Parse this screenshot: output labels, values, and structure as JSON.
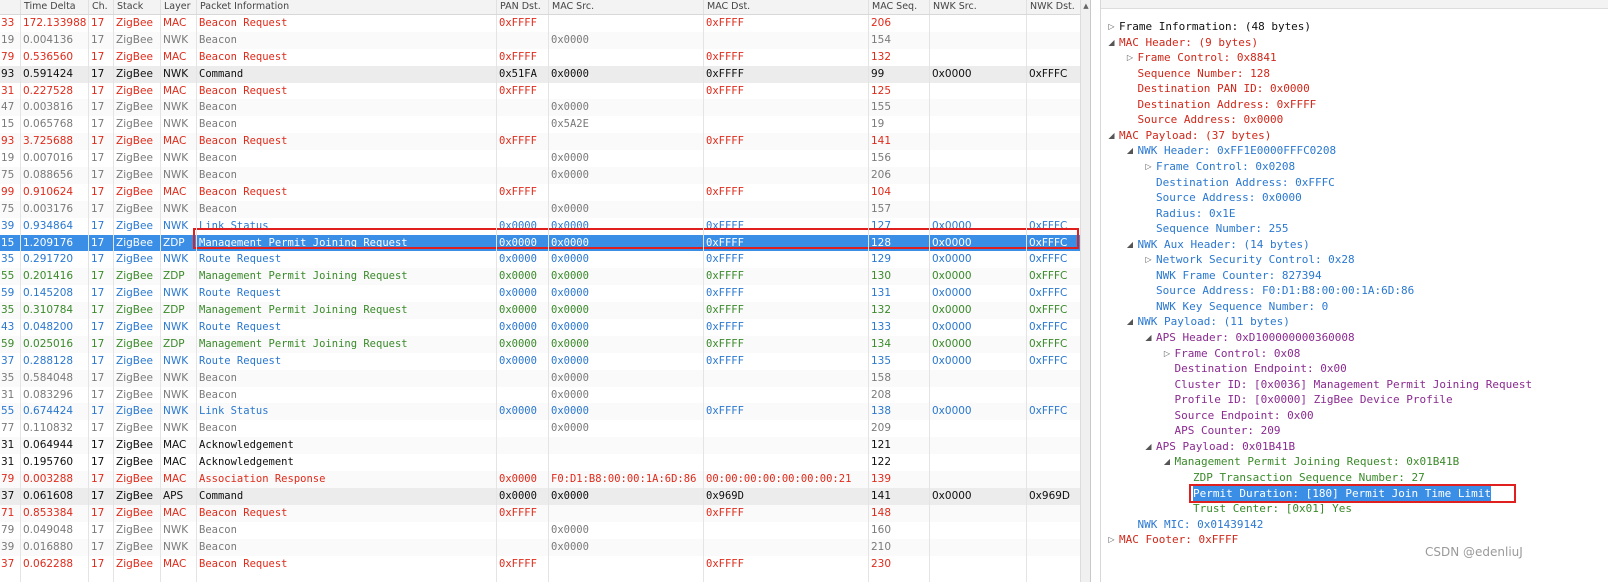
{
  "columns": [
    "Time Delta",
    "Ch.",
    "Stack",
    "Layer",
    "Packet Information",
    "PAN Dst.",
    "MAC Src.",
    "MAC Dst.",
    "MAC Seq.",
    "NWK Src.",
    "NWK Dst."
  ],
  "colors": {
    "beacon_req": "#e02a1a",
    "nwk": "#7a7a7a",
    "link": "#2a78d0",
    "zdp": "#3a8a2a",
    "ack": "#101010",
    "cmd": "#101010",
    "selected_bg": "#3a8ee6",
    "highlight_border": "#e0201e"
  },
  "rows": [
    {
      "no": "33",
      "delta": "172.133988",
      "ch": "17",
      "stack": "ZigBee",
      "layer": "MAC",
      "info": "Beacon Request",
      "pan": "0xFFFF",
      "msrc": "",
      "mdst": "0xFFFF",
      "seq": "206",
      "nsrc": "",
      "ndst": "",
      "kind": "beacon_req"
    },
    {
      "no": "19",
      "delta": "0.004136",
      "ch": "17",
      "stack": "ZigBee",
      "layer": "NWK",
      "info": "Beacon",
      "pan": "",
      "msrc": "0x0000",
      "mdst": "",
      "seq": "154",
      "nsrc": "",
      "ndst": "",
      "kind": "nwk"
    },
    {
      "no": "79",
      "delta": "0.536560",
      "ch": "17",
      "stack": "ZigBee",
      "layer": "MAC",
      "info": "Beacon Request",
      "pan": "0xFFFF",
      "msrc": "",
      "mdst": "0xFFFF",
      "seq": "132",
      "nsrc": "",
      "ndst": "",
      "kind": "beacon_req"
    },
    {
      "no": "93",
      "delta": "0.591424",
      "ch": "17",
      "stack": "ZigBee",
      "layer": "NWK",
      "info": "Command",
      "pan": "0x51FA",
      "msrc": "0x0000",
      "mdst": "0xFFFF",
      "seq": "99",
      "nsrc": "0x0000",
      "ndst": "0xFFFC",
      "kind": "cmd"
    },
    {
      "no": "31",
      "delta": "0.227528",
      "ch": "17",
      "stack": "ZigBee",
      "layer": "MAC",
      "info": "Beacon Request",
      "pan": "0xFFFF",
      "msrc": "",
      "mdst": "0xFFFF",
      "seq": "125",
      "nsrc": "",
      "ndst": "",
      "kind": "beacon_req"
    },
    {
      "no": "47",
      "delta": "0.003816",
      "ch": "17",
      "stack": "ZigBee",
      "layer": "NWK",
      "info": "Beacon",
      "pan": "",
      "msrc": "0x0000",
      "mdst": "",
      "seq": "155",
      "nsrc": "",
      "ndst": "",
      "kind": "nwk"
    },
    {
      "no": "15",
      "delta": "0.065768",
      "ch": "17",
      "stack": "ZigBee",
      "layer": "NWK",
      "info": "Beacon",
      "pan": "",
      "msrc": "0x5A2E",
      "mdst": "",
      "seq": "19",
      "nsrc": "",
      "ndst": "",
      "kind": "nwk"
    },
    {
      "no": "93",
      "delta": "3.725688",
      "ch": "17",
      "stack": "ZigBee",
      "layer": "MAC",
      "info": "Beacon Request",
      "pan": "0xFFFF",
      "msrc": "",
      "mdst": "0xFFFF",
      "seq": "141",
      "nsrc": "",
      "ndst": "",
      "kind": "beacon_req"
    },
    {
      "no": "19",
      "delta": "0.007016",
      "ch": "17",
      "stack": "ZigBee",
      "layer": "NWK",
      "info": "Beacon",
      "pan": "",
      "msrc": "0x0000",
      "mdst": "",
      "seq": "156",
      "nsrc": "",
      "ndst": "",
      "kind": "nwk"
    },
    {
      "no": "75",
      "delta": "0.088656",
      "ch": "17",
      "stack": "ZigBee",
      "layer": "NWK",
      "info": "Beacon",
      "pan": "",
      "msrc": "0x0000",
      "mdst": "",
      "seq": "206",
      "nsrc": "",
      "ndst": "",
      "kind": "nwk"
    },
    {
      "no": "99",
      "delta": "0.910624",
      "ch": "17",
      "stack": "ZigBee",
      "layer": "MAC",
      "info": "Beacon Request",
      "pan": "0xFFFF",
      "msrc": "",
      "mdst": "0xFFFF",
      "seq": "104",
      "nsrc": "",
      "ndst": "",
      "kind": "beacon_req"
    },
    {
      "no": "75",
      "delta": "0.003176",
      "ch": "17",
      "stack": "ZigBee",
      "layer": "NWK",
      "info": "Beacon",
      "pan": "",
      "msrc": "0x0000",
      "mdst": "",
      "seq": "157",
      "nsrc": "",
      "ndst": "",
      "kind": "nwk"
    },
    {
      "no": "39",
      "delta": "0.934864",
      "ch": "17",
      "stack": "ZigBee",
      "layer": "NWK",
      "info": "Link Status",
      "pan": "0x0000",
      "msrc": "0x0000",
      "mdst": "0xFFFF",
      "seq": "127",
      "nsrc": "0x0000",
      "ndst": "0xFFFC",
      "kind": "link"
    },
    {
      "no": "15",
      "delta": "1.209176",
      "ch": "17",
      "stack": "ZigBee",
      "layer": "ZDP",
      "info": "Management Permit Joining Request",
      "pan": "0x0000",
      "msrc": "0x0000",
      "mdst": "0xFFFF",
      "seq": "128",
      "nsrc": "0x0000",
      "ndst": "0xFFFC",
      "kind": "zdp",
      "selected": true
    },
    {
      "no": "35",
      "delta": "0.291720",
      "ch": "17",
      "stack": "ZigBee",
      "layer": "NWK",
      "info": "Route Request",
      "pan": "0x0000",
      "msrc": "0x0000",
      "mdst": "0xFFFF",
      "seq": "129",
      "nsrc": "0x0000",
      "ndst": "0xFFFC",
      "kind": "link"
    },
    {
      "no": "55",
      "delta": "0.201416",
      "ch": "17",
      "stack": "ZigBee",
      "layer": "ZDP",
      "info": "Management Permit Joining Request",
      "pan": "0x0000",
      "msrc": "0x0000",
      "mdst": "0xFFFF",
      "seq": "130",
      "nsrc": "0x0000",
      "ndst": "0xFFFC",
      "kind": "zdp"
    },
    {
      "no": "59",
      "delta": "0.145208",
      "ch": "17",
      "stack": "ZigBee",
      "layer": "NWK",
      "info": "Route Request",
      "pan": "0x0000",
      "msrc": "0x0000",
      "mdst": "0xFFFF",
      "seq": "131",
      "nsrc": "0x0000",
      "ndst": "0xFFFC",
      "kind": "link"
    },
    {
      "no": "35",
      "delta": "0.310784",
      "ch": "17",
      "stack": "ZigBee",
      "layer": "ZDP",
      "info": "Management Permit Joining Request",
      "pan": "0x0000",
      "msrc": "0x0000",
      "mdst": "0xFFFF",
      "seq": "132",
      "nsrc": "0x0000",
      "ndst": "0xFFFC",
      "kind": "zdp"
    },
    {
      "no": "43",
      "delta": "0.048200",
      "ch": "17",
      "stack": "ZigBee",
      "layer": "NWK",
      "info": "Route Request",
      "pan": "0x0000",
      "msrc": "0x0000",
      "mdst": "0xFFFF",
      "seq": "133",
      "nsrc": "0x0000",
      "ndst": "0xFFFC",
      "kind": "link"
    },
    {
      "no": "59",
      "delta": "0.025016",
      "ch": "17",
      "stack": "ZigBee",
      "layer": "ZDP",
      "info": "Management Permit Joining Request",
      "pan": "0x0000",
      "msrc": "0x0000",
      "mdst": "0xFFFF",
      "seq": "134",
      "nsrc": "0x0000",
      "ndst": "0xFFFC",
      "kind": "zdp"
    },
    {
      "no": "37",
      "delta": "0.288128",
      "ch": "17",
      "stack": "ZigBee",
      "layer": "NWK",
      "info": "Route Request",
      "pan": "0x0000",
      "msrc": "0x0000",
      "mdst": "0xFFFF",
      "seq": "135",
      "nsrc": "0x0000",
      "ndst": "0xFFFC",
      "kind": "link"
    },
    {
      "no": "35",
      "delta": "0.584048",
      "ch": "17",
      "stack": "ZigBee",
      "layer": "NWK",
      "info": "Beacon",
      "pan": "",
      "msrc": "0x0000",
      "mdst": "",
      "seq": "158",
      "nsrc": "",
      "ndst": "",
      "kind": "nwk"
    },
    {
      "no": "31",
      "delta": "0.083296",
      "ch": "17",
      "stack": "ZigBee",
      "layer": "NWK",
      "info": "Beacon",
      "pan": "",
      "msrc": "0x0000",
      "mdst": "",
      "seq": "208",
      "nsrc": "",
      "ndst": "",
      "kind": "nwk"
    },
    {
      "no": "55",
      "delta": "0.674424",
      "ch": "17",
      "stack": "ZigBee",
      "layer": "NWK",
      "info": "Link Status",
      "pan": "0x0000",
      "msrc": "0x0000",
      "mdst": "0xFFFF",
      "seq": "138",
      "nsrc": "0x0000",
      "ndst": "0xFFFC",
      "kind": "link"
    },
    {
      "no": "77",
      "delta": "0.110832",
      "ch": "17",
      "stack": "ZigBee",
      "layer": "NWK",
      "info": "Beacon",
      "pan": "",
      "msrc": "0x0000",
      "mdst": "",
      "seq": "209",
      "nsrc": "",
      "ndst": "",
      "kind": "nwk"
    },
    {
      "no": "31",
      "delta": "0.064944",
      "ch": "17",
      "stack": "ZigBee",
      "layer": "MAC",
      "info": "Acknowledgement",
      "pan": "",
      "msrc": "",
      "mdst": "",
      "seq": "121",
      "nsrc": "",
      "ndst": "",
      "kind": "ack"
    },
    {
      "no": "31",
      "delta": "0.195760",
      "ch": "17",
      "stack": "ZigBee",
      "layer": "MAC",
      "info": "Acknowledgement",
      "pan": "",
      "msrc": "",
      "mdst": "",
      "seq": "122",
      "nsrc": "",
      "ndst": "",
      "kind": "ack"
    },
    {
      "no": "79",
      "delta": "0.003288",
      "ch": "17",
      "stack": "ZigBee",
      "layer": "MAC",
      "info": "Association Response",
      "pan": "0x0000",
      "msrc": "F0:D1:B8:00:00:1A:6D:86",
      "mdst": "00:00:00:00:00:00:00:21",
      "seq": "139",
      "nsrc": "",
      "ndst": "",
      "kind": "beacon_req"
    },
    {
      "no": "37",
      "delta": "0.061608",
      "ch": "17",
      "stack": "ZigBee",
      "layer": "APS",
      "info": "Command",
      "pan": "0x0000",
      "msrc": "0x0000",
      "mdst": "0x969D",
      "seq": "141",
      "nsrc": "0x0000",
      "ndst": "0x969D",
      "kind": "cmd"
    },
    {
      "no": "71",
      "delta": "0.853384",
      "ch": "17",
      "stack": "ZigBee",
      "layer": "MAC",
      "info": "Beacon Request",
      "pan": "0xFFFF",
      "msrc": "",
      "mdst": "0xFFFF",
      "seq": "148",
      "nsrc": "",
      "ndst": "",
      "kind": "beacon_req"
    },
    {
      "no": "79",
      "delta": "0.049048",
      "ch": "17",
      "stack": "ZigBee",
      "layer": "NWK",
      "info": "Beacon",
      "pan": "",
      "msrc": "0x0000",
      "mdst": "",
      "seq": "160",
      "nsrc": "",
      "ndst": "",
      "kind": "nwk"
    },
    {
      "no": "39",
      "delta": "0.016880",
      "ch": "17",
      "stack": "ZigBee",
      "layer": "NWK",
      "info": "Beacon",
      "pan": "",
      "msrc": "0x0000",
      "mdst": "",
      "seq": "210",
      "nsrc": "",
      "ndst": "",
      "kind": "nwk"
    },
    {
      "no": "37",
      "delta": "0.062288",
      "ch": "17",
      "stack": "ZigBee",
      "layer": "MAC",
      "info": "Beacon Request",
      "pan": "0xFFFF",
      "msrc": "",
      "mdst": "0xFFFF",
      "seq": "230",
      "nsrc": "",
      "ndst": "",
      "kind": "beacon_req"
    }
  ],
  "tree": [
    {
      "text": "Frame Information: (48 bytes)",
      "depth": 0,
      "tw": "closed",
      "color": "#101010"
    },
    {
      "text": "MAC Header: (9 bytes)",
      "depth": 0,
      "tw": "open",
      "color": "#d0281a"
    },
    {
      "text": "Frame Control: 0x8841",
      "depth": 1,
      "tw": "closed",
      "color": "#d0281a"
    },
    {
      "text": "Sequence Number: 128",
      "depth": 1,
      "tw": "",
      "color": "#d0281a"
    },
    {
      "text": "Destination PAN ID: 0x0000",
      "depth": 1,
      "tw": "",
      "color": "#d0281a"
    },
    {
      "text": "Destination Address: 0xFFFF",
      "depth": 1,
      "tw": "",
      "color": "#d0281a"
    },
    {
      "text": "Source Address: 0x0000",
      "depth": 1,
      "tw": "",
      "color": "#d0281a"
    },
    {
      "text": "MAC Payload: (37 bytes)",
      "depth": 0,
      "tw": "open",
      "color": "#d0281a"
    },
    {
      "text": "NWK Header: 0xFF1E0000FFFC0208",
      "depth": 1,
      "tw": "open",
      "color": "#2a78d0"
    },
    {
      "text": "Frame Control: 0x0208",
      "depth": 2,
      "tw": "closed",
      "color": "#2a78d0"
    },
    {
      "text": "Destination Address: 0xFFFC",
      "depth": 2,
      "tw": "",
      "color": "#2a78d0"
    },
    {
      "text": "Source Address: 0x0000",
      "depth": 2,
      "tw": "",
      "color": "#2a78d0"
    },
    {
      "text": "Radius: 0x1E",
      "depth": 2,
      "tw": "",
      "color": "#2a78d0"
    },
    {
      "text": "Sequence Number: 255",
      "depth": 2,
      "tw": "",
      "color": "#2a78d0"
    },
    {
      "text": "NWK Aux Header: (14 bytes)",
      "depth": 1,
      "tw": "open",
      "color": "#2a78d0"
    },
    {
      "text": "Network Security Control: 0x28",
      "depth": 2,
      "tw": "closed",
      "color": "#2a78d0"
    },
    {
      "text": "NWK Frame Counter: 827394",
      "depth": 2,
      "tw": "",
      "color": "#2a78d0"
    },
    {
      "text": "Source Address: F0:D1:B8:00:00:1A:6D:86",
      "depth": 2,
      "tw": "",
      "color": "#2a78d0"
    },
    {
      "text": "NWK Key Sequence Number: 0",
      "depth": 2,
      "tw": "",
      "color": "#2a78d0"
    },
    {
      "text": "NWK Payload: (11 bytes)",
      "depth": 1,
      "tw": "open",
      "color": "#2a78d0"
    },
    {
      "text": "APS Header: 0xD100000000360008",
      "depth": 2,
      "tw": "open",
      "color": "#8a2a90"
    },
    {
      "text": "Frame Control: 0x08",
      "depth": 3,
      "tw": "closed",
      "color": "#8a2a90"
    },
    {
      "text": "Destination Endpoint: 0x00",
      "depth": 3,
      "tw": "",
      "color": "#8a2a90"
    },
    {
      "text": "Cluster ID: [0x0036] Management Permit Joining Request",
      "depth": 3,
      "tw": "",
      "color": "#8a2a90"
    },
    {
      "text": "Profile ID: [0x0000] ZigBee Device Profile",
      "depth": 3,
      "tw": "",
      "color": "#8a2a90"
    },
    {
      "text": "Source Endpoint: 0x00",
      "depth": 3,
      "tw": "",
      "color": "#8a2a90"
    },
    {
      "text": "APS Counter: 209",
      "depth": 3,
      "tw": "",
      "color": "#8a2a90"
    },
    {
      "text": "APS Payload: 0x01B41B",
      "depth": 2,
      "tw": "open",
      "color": "#8a2a90"
    },
    {
      "text": "Management Permit Joining Request: 0x01B41B",
      "depth": 3,
      "tw": "open",
      "color": "#3a8a2a"
    },
    {
      "text": "ZDP Transaction Sequence Number: 27",
      "depth": 4,
      "tw": "",
      "color": "#3a8a2a"
    },
    {
      "text": "Permit Duration: [180] Permit Join Time Limit",
      "depth": 4,
      "tw": "",
      "color": "#3a8a2a",
      "selected": true
    },
    {
      "text": "Trust Center: [0x01] Yes",
      "depth": 4,
      "tw": "",
      "color": "#3a8a2a"
    },
    {
      "text": "NWK MIC: 0x01439142",
      "depth": 1,
      "tw": "",
      "color": "#2a78d0"
    },
    {
      "text": "MAC Footer: 0xFFFF",
      "depth": 0,
      "tw": "closed",
      "color": "#d0281a"
    }
  ],
  "watermark": "CSDN @edenliuJ"
}
